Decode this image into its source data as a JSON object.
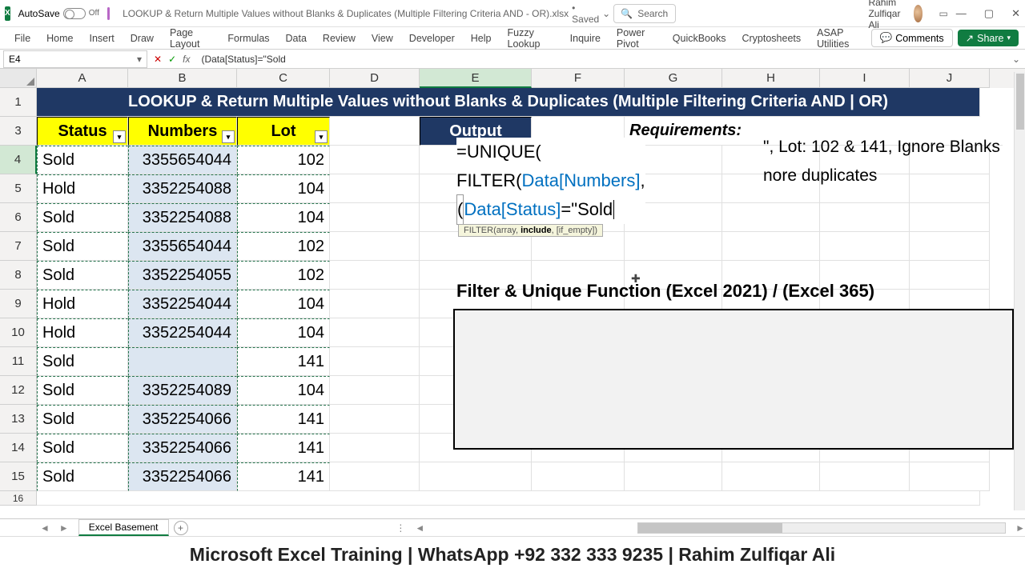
{
  "titlebar": {
    "autosave_label": "AutoSave",
    "autosave_state": "Off",
    "doc_title": "LOOKUP & Return Multiple Values without Blanks & Duplicates (Multiple Filtering Criteria AND - OR).xlsx",
    "saved_label": "• Saved",
    "search_placeholder": "Search",
    "user_name": "Rahim Zulfiqar Ali"
  },
  "ribbon": {
    "tabs": [
      "File",
      "Home",
      "Insert",
      "Draw",
      "Page Layout",
      "Formulas",
      "Data",
      "Review",
      "View",
      "Developer",
      "Help",
      "Fuzzy Lookup",
      "Inquire",
      "Power Pivot",
      "QuickBooks",
      "Cryptosheets",
      "ASAP Utilities"
    ],
    "comments": "Comments",
    "share": "Share"
  },
  "formulabar": {
    "cell_ref": "E4",
    "formula": "(Data[Status]=\"Sold"
  },
  "columns": [
    "A",
    "B",
    "C",
    "D",
    "E",
    "F",
    "G",
    "H",
    "I",
    "J"
  ],
  "row1_title": "LOOKUP & Return Multiple Values without Blanks & Duplicates (Multiple Filtering Criteria AND | OR)",
  "headers": {
    "status": "Status",
    "numbers": "Numbers",
    "lot": "Lot",
    "output": "Output",
    "requirements": "Requirements:"
  },
  "table": [
    {
      "r": 4,
      "status": "Sold",
      "numbers": "3355654044",
      "lot": "102"
    },
    {
      "r": 5,
      "status": "Hold",
      "numbers": "3352254088",
      "lot": "104"
    },
    {
      "r": 6,
      "status": "Sold",
      "numbers": "3352254088",
      "lot": "104"
    },
    {
      "r": 7,
      "status": "Sold",
      "numbers": "3355654044",
      "lot": "102"
    },
    {
      "r": 8,
      "status": "Sold",
      "numbers": "3352254055",
      "lot": "102"
    },
    {
      "r": 9,
      "status": "Hold",
      "numbers": "3352254044",
      "lot": "104"
    },
    {
      "r": 10,
      "status": "Hold",
      "numbers": "3352254044",
      "lot": "104"
    },
    {
      "r": 11,
      "status": "Sold",
      "numbers": "",
      "lot": "141"
    },
    {
      "r": 12,
      "status": "Sold",
      "numbers": "3352254089",
      "lot": "104"
    },
    {
      "r": 13,
      "status": "Sold",
      "numbers": "3352254066",
      "lot": "141"
    },
    {
      "r": 14,
      "status": "Sold",
      "numbers": "3352254066",
      "lot": "141"
    },
    {
      "r": 15,
      "status": "Sold",
      "numbers": "3352254066",
      "lot": "141"
    }
  ],
  "formula_overlay": {
    "line1_a": "=UNIQUE(",
    "line2_a": "FILTER(",
    "line2_b": "Data[Numbers]",
    "line2_c": ",",
    "line3_a": "(",
    "line3_b": "Data[Status]",
    "line3_c": "=\"Sold"
  },
  "tooltip": {
    "pre": "FILTER(array, ",
    "bold": "include",
    "post": ", [if_empty])"
  },
  "side": {
    "line1": "\", Lot: 102 & 141, Ignore Blanks",
    "line2": "nore duplicates"
  },
  "section_title": "Filter & Unique Function (Excel 2021) / (Excel 365)",
  "sheettab": "Excel Basement",
  "footer": "Microsoft Excel Training | WhatsApp +92 332 333 9235 | Rahim Zulfiqar Ali"
}
